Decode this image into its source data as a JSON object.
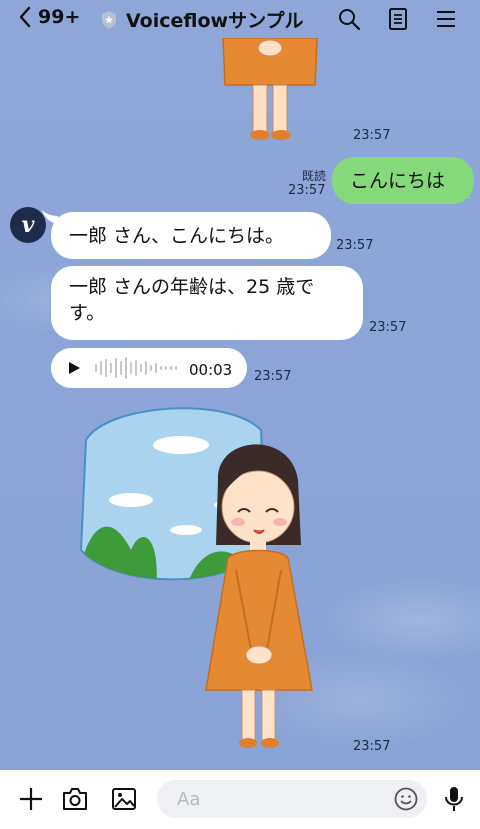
{
  "header": {
    "back_count": "99+",
    "title": "Voiceflowサンプル"
  },
  "messages": {
    "img1_time": "23:57",
    "sent_text": "こんにちは",
    "sent_read": "既読",
    "sent_time": "23:57",
    "bot_msg1": "一郎 さん、こんにちは。",
    "bot_msg1_time": "23:57",
    "bot_msg2_line1": "一郎 さんの年齢は、25 歳で",
    "bot_msg2_line2": "す。",
    "bot_msg2_time": "23:57",
    "audio_duration": "00:03",
    "audio_time": "23:57",
    "img2_time": "23:57"
  },
  "composer": {
    "placeholder": "Aa"
  },
  "icons": [
    "back-chevron-icon",
    "shield-star-icon",
    "search-icon",
    "notes-icon",
    "menu-icon",
    "plus-icon",
    "camera-icon",
    "image-icon",
    "emoji-icon",
    "mic-icon",
    "play-icon"
  ]
}
